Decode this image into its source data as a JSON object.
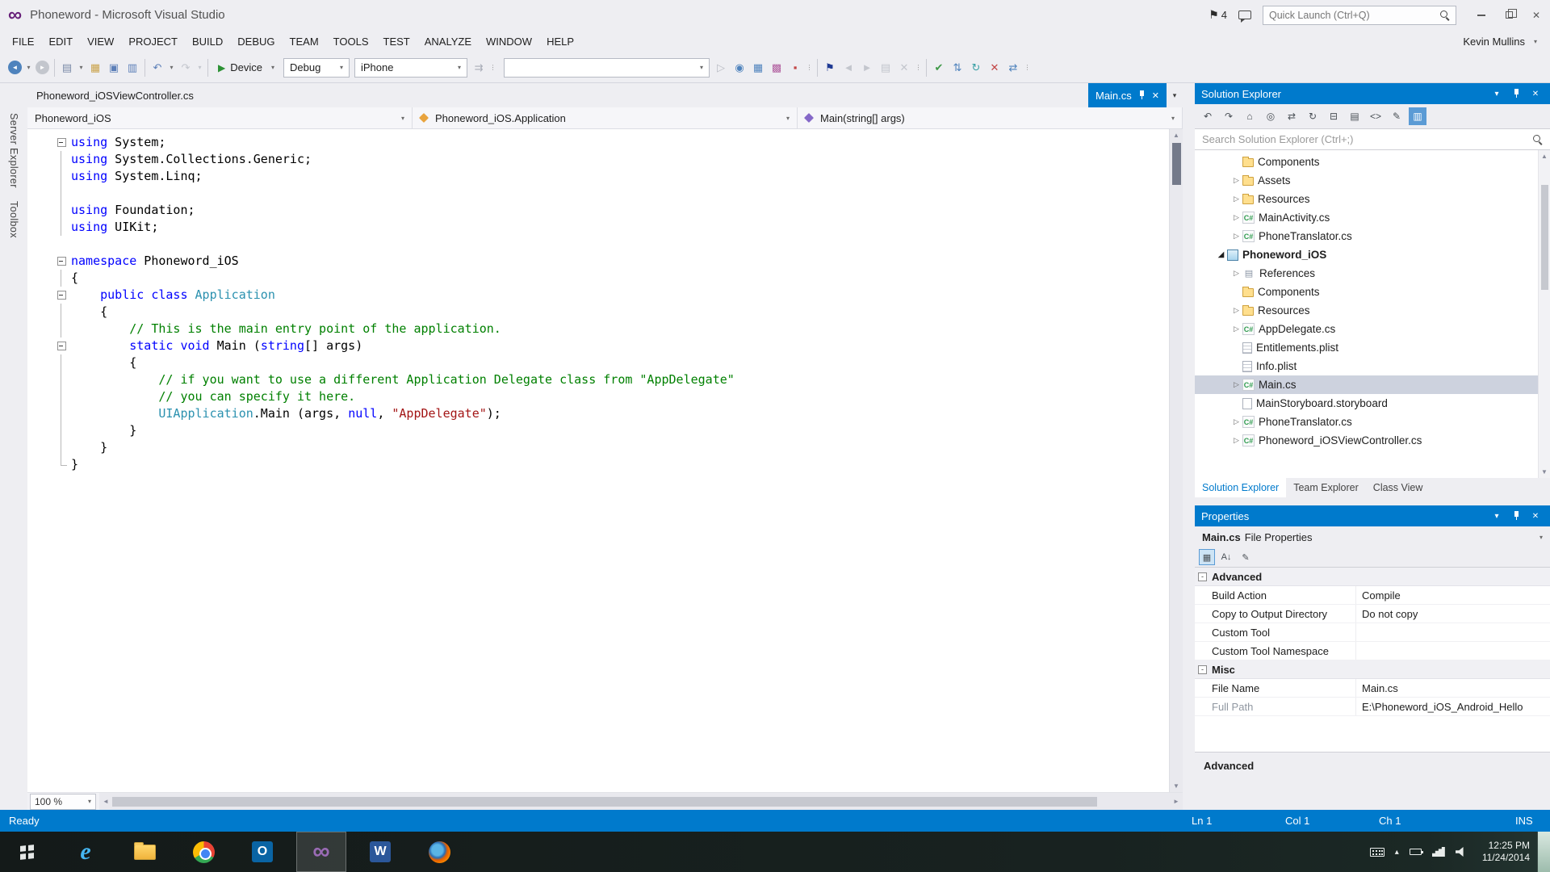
{
  "window": {
    "title": "Phoneword - Microsoft Visual Studio"
  },
  "title_bar": {
    "notification_count": "4",
    "quick_launch_placeholder": "Quick Launch (Ctrl+Q)"
  },
  "menu_bar": {
    "items": [
      "FILE",
      "EDIT",
      "VIEW",
      "PROJECT",
      "BUILD",
      "DEBUG",
      "TEAM",
      "TOOLS",
      "TEST",
      "ANALYZE",
      "WINDOW",
      "HELP"
    ],
    "user": "Kevin Mullins"
  },
  "toolbar": {
    "start_label": "Device",
    "config": "Debug",
    "platform": "iPhone",
    "groups": [
      [
        {
          "n": "navigate-backward-icon",
          "g": "◄",
          "fg": "#ffffff",
          "bg": "#4f83bd",
          "r": true
        },
        {
          "n": "navigate-backward-caret-icon",
          "g": "▾",
          "fg": "#6d6d6d",
          "sm": true
        },
        {
          "n": "navigate-forward-icon",
          "g": "►",
          "fg": "#ffffff",
          "bg": "#c3c6cd",
          "r": true
        }
      ],
      [
        {
          "n": "new-file-icon",
          "g": "▤",
          "fg": "#7a8aa8"
        },
        {
          "n": "new-file-caret-icon",
          "g": "▾",
          "fg": "#6d6d6d",
          "sm": true
        },
        {
          "n": "open-file-icon",
          "g": "▦",
          "fg": "#caa34c"
        },
        {
          "n": "save-icon",
          "g": "▣",
          "fg": "#5c7fb8"
        },
        {
          "n": "save-all-icon",
          "g": "▥",
          "fg": "#5c7fb8"
        }
      ],
      [
        {
          "n": "undo-icon",
          "g": "↶",
          "fg": "#5c7fb8"
        },
        {
          "n": "undo-caret-icon",
          "g": "▾",
          "fg": "#6d6d6d",
          "sm": true
        },
        {
          "n": "redo-icon",
          "g": "↷",
          "fg": "#c3c6cd"
        },
        {
          "n": "redo-caret-icon",
          "g": "▾",
          "fg": "#c3c6cd",
          "sm": true
        }
      ],
      [
        {
          "n": "attach-to-process-icon",
          "g": "⇉",
          "fg": "#a9adb8"
        },
        {
          "n": "toolbar-options-icon",
          "g": "⋮",
          "fg": "#8a8a8a",
          "sm": true
        }
      ],
      [
        {
          "n": "find-next-icon",
          "g": "▷",
          "fg": "#b9bcc4"
        },
        {
          "n": "info-icon",
          "g": "◉",
          "fg": "#4f83bd"
        },
        {
          "n": "data-grid-icon",
          "g": "▦",
          "fg": "#4f83bd"
        },
        {
          "n": "data-table-icon",
          "g": "▩",
          "fg": "#b05c9e"
        },
        {
          "n": "stop-icon",
          "g": "▪",
          "fg": "#c24545"
        },
        {
          "n": "group-overflow-icon",
          "g": "⋮",
          "fg": "#8a8a8a",
          "sm": true
        }
      ],
      [
        {
          "n": "bookmark-icon",
          "g": "⚑",
          "fg": "#1f3a93"
        },
        {
          "n": "previous-bookmark-icon",
          "g": "◄",
          "fg": "#c3c6cd"
        },
        {
          "n": "next-bookmark-icon",
          "g": "►",
          "fg": "#c3c6cd"
        },
        {
          "n": "bookmark-folder-icon",
          "g": "▤",
          "fg": "#c3c6cd"
        },
        {
          "n": "clear-bookmarks-icon",
          "g": "✕",
          "fg": "#c3c6cd"
        },
        {
          "n": "bookmark-overflow-icon",
          "g": "⋮",
          "fg": "#8a8a8a",
          "sm": true
        }
      ],
      [
        {
          "n": "source-control-check-icon",
          "g": "✔",
          "fg": "#3f9948"
        },
        {
          "n": "branch-icon",
          "g": "⇅",
          "fg": "#4f83bd"
        },
        {
          "n": "sync-icon",
          "g": "↻",
          "fg": "#3aa0a5"
        },
        {
          "n": "undo-checkout-icon",
          "g": "✕",
          "fg": "#c24545"
        },
        {
          "n": "compare-icon",
          "g": "⇄",
          "fg": "#4f83bd"
        },
        {
          "n": "history-overflow-icon",
          "g": "⋮",
          "fg": "#8a8a8a",
          "sm": true
        }
      ]
    ]
  },
  "side_tabs": [
    {
      "label": "Server Explorer"
    },
    {
      "label": "Toolbox"
    }
  ],
  "editor": {
    "tabs": [
      {
        "label": "Phoneword_iOSViewController.cs"
      }
    ],
    "preview_tab": {
      "label": "Main.cs"
    },
    "navbar": [
      {
        "label": "Phoneword_iOS"
      },
      {
        "label": "Phoneword_iOS.Application"
      },
      {
        "label": "Main(string[] args)"
      }
    ],
    "zoom": "100 %",
    "code": [
      {
        "m": "box",
        "seg": [
          [
            "kw",
            "using"
          ],
          [
            "pl",
            " System;"
          ]
        ]
      },
      {
        "m": "line",
        "seg": [
          [
            "kw",
            "using"
          ],
          [
            "pl",
            " System.Collections.Generic;"
          ]
        ]
      },
      {
        "m": "line",
        "seg": [
          [
            "kw",
            "using"
          ],
          [
            "pl",
            " System.Linq;"
          ]
        ]
      },
      {
        "m": "line",
        "seg": []
      },
      {
        "m": "line",
        "seg": [
          [
            "kw",
            "using"
          ],
          [
            "pl",
            " Foundation;"
          ]
        ]
      },
      {
        "m": "line",
        "seg": [
          [
            "kw",
            "using"
          ],
          [
            "pl",
            " UIKit;"
          ]
        ]
      },
      {
        "m": "",
        "seg": []
      },
      {
        "m": "box",
        "seg": [
          [
            "kw",
            "namespace"
          ],
          [
            "pl",
            " Phoneword_iOS"
          ]
        ]
      },
      {
        "m": "line",
        "seg": [
          [
            "pl",
            "{"
          ]
        ]
      },
      {
        "m": "box",
        "seg": [
          [
            "pl",
            "    "
          ],
          [
            "kw",
            "public"
          ],
          [
            "pl",
            " "
          ],
          [
            "kw",
            "class"
          ],
          [
            "pl",
            " "
          ],
          [
            "ty",
            "Application"
          ]
        ]
      },
      {
        "m": "line",
        "seg": [
          [
            "pl",
            "    {"
          ]
        ]
      },
      {
        "m": "line",
        "seg": [
          [
            "pl",
            "        "
          ],
          [
            "com",
            "// This is the main entry point of the application."
          ]
        ]
      },
      {
        "m": "box",
        "seg": [
          [
            "pl",
            "        "
          ],
          [
            "kw",
            "static"
          ],
          [
            "pl",
            " "
          ],
          [
            "kw",
            "void"
          ],
          [
            "pl",
            " Main ("
          ],
          [
            "kw",
            "string"
          ],
          [
            "pl",
            "[] args)"
          ]
        ]
      },
      {
        "m": "line",
        "seg": [
          [
            "pl",
            "        {"
          ]
        ]
      },
      {
        "m": "line",
        "seg": [
          [
            "pl",
            "            "
          ],
          [
            "com",
            "// if you want to use a different Application Delegate class from \"AppDelegate\""
          ]
        ]
      },
      {
        "m": "line",
        "seg": [
          [
            "pl",
            "            "
          ],
          [
            "com",
            "// you can specify it here."
          ]
        ]
      },
      {
        "m": "line",
        "seg": [
          [
            "pl",
            "            "
          ],
          [
            "ty",
            "UIApplication"
          ],
          [
            "pl",
            ".Main (args, "
          ],
          [
            "kw",
            "null"
          ],
          [
            "pl",
            ", "
          ],
          [
            "str",
            "\"AppDelegate\""
          ],
          [
            "pl",
            ");"
          ]
        ]
      },
      {
        "m": "line",
        "seg": [
          [
            "pl",
            "        }"
          ]
        ]
      },
      {
        "m": "line",
        "seg": [
          [
            "pl",
            "    }"
          ]
        ]
      },
      {
        "m": "end",
        "seg": [
          [
            "pl",
            "}"
          ]
        ]
      }
    ]
  },
  "solution_explorer": {
    "title": "Solution Explorer",
    "search_placeholder": "Search Solution Explorer (Ctrl+;)",
    "toolbar_icons": [
      {
        "n": "se-back-icon",
        "g": "↶"
      },
      {
        "n": "se-forward-icon",
        "g": "↷"
      },
      {
        "n": "se-home-icon",
        "g": "⌂"
      },
      {
        "n": "se-scope-icon",
        "g": "◎"
      },
      {
        "n": "se-sync-with-active-document-icon",
        "g": "⇄"
      },
      {
        "n": "se-refresh-icon",
        "g": "↻"
      },
      {
        "n": "se-collapse-all-icon",
        "g": "⊟"
      },
      {
        "n": "se-show-all-files-icon",
        "g": "▤"
      },
      {
        "n": "se-view-code-icon",
        "g": "<>"
      },
      {
        "n": "se-properties-icon",
        "g": "✎"
      },
      {
        "n": "se-preview-selected-icon",
        "g": "▥",
        "active": true
      }
    ],
    "tree": [
      {
        "indent": 2,
        "arrow": "none",
        "icon": "folder",
        "label": "Components"
      },
      {
        "indent": 2,
        "arrow": "collapsed",
        "icon": "folder",
        "label": "Assets"
      },
      {
        "indent": 2,
        "arrow": "collapsed",
        "icon": "folder",
        "label": "Resources"
      },
      {
        "indent": 2,
        "arrow": "collapsed",
        "icon": "csharp",
        "label": "MainActivity.cs"
      },
      {
        "indent": 2,
        "arrow": "collapsed",
        "icon": "csharp",
        "label": "PhoneTranslator.cs"
      },
      {
        "indent": 1,
        "arrow": "expanded",
        "icon": "project",
        "label": "Phoneword_iOS",
        "bold": true
      },
      {
        "indent": 2,
        "arrow": "collapsed",
        "icon": "references",
        "label": "References"
      },
      {
        "indent": 2,
        "arrow": "none",
        "icon": "folder",
        "label": "Components"
      },
      {
        "indent": 2,
        "arrow": "collapsed",
        "icon": "folder",
        "label": "Resources"
      },
      {
        "indent": 2,
        "arrow": "collapsed",
        "icon": "csharp",
        "label": "AppDelegate.cs"
      },
      {
        "indent": 2,
        "arrow": "none",
        "icon": "plist",
        "label": "Entitlements.plist"
      },
      {
        "indent": 2,
        "arrow": "none",
        "icon": "plist",
        "label": "Info.plist"
      },
      {
        "indent": 2,
        "arrow": "collapsed",
        "icon": "csharp",
        "label": "Main.cs",
        "selected": true
      },
      {
        "indent": 2,
        "arrow": "none",
        "icon": "storyboard",
        "label": "MainStoryboard.storyboard"
      },
      {
        "indent": 2,
        "arrow": "collapsed",
        "icon": "csharp",
        "label": "PhoneTranslator.cs"
      },
      {
        "indent": 2,
        "arrow": "collapsed",
        "icon": "csharp",
        "label": "Phoneword_iOSViewController.cs"
      }
    ],
    "bottom_tabs": [
      {
        "label": "Solution Explorer",
        "active": true
      },
      {
        "label": "Team Explorer"
      },
      {
        "label": "Class View"
      }
    ]
  },
  "properties_panel": {
    "title": "Properties",
    "object_label": "Main.cs",
    "object_type": "File Properties",
    "toolbar_icons": [
      {
        "n": "categorized-icon",
        "g": "▦",
        "active": true
      },
      {
        "n": "alphabetical-icon",
        "g": "A↓"
      },
      {
        "n": "property-pages-icon",
        "g": "✎"
      }
    ],
    "rows": [
      {
        "type": "category",
        "label": "Advanced"
      },
      {
        "type": "prop",
        "label": "Build Action",
        "value": "Compile"
      },
      {
        "type": "prop",
        "label": "Copy to Output Directory",
        "value": "Do not copy"
      },
      {
        "type": "prop",
        "label": "Custom Tool",
        "value": ""
      },
      {
        "type": "prop",
        "label": "Custom Tool Namespace",
        "value": ""
      },
      {
        "type": "category",
        "label": "Misc"
      },
      {
        "type": "prop",
        "label": "File Name",
        "value": "Main.cs"
      },
      {
        "type": "prop",
        "label": "Full Path",
        "value": "E:\\Phoneword_iOS_Android_Hello",
        "muted": true
      }
    ],
    "description_title": "Advanced"
  },
  "status_bar": {
    "left": "Ready",
    "ln": "Ln 1",
    "col": "Col 1",
    "ch": "Ch 1",
    "mode": "INS"
  },
  "taskbar": {
    "apps": [
      {
        "id": "start"
      },
      {
        "id": "internet-explorer",
        "glyph": "e"
      },
      {
        "id": "file-explorer"
      },
      {
        "id": "chrome"
      },
      {
        "id": "outlook",
        "glyph": "O"
      },
      {
        "id": "visual-studio",
        "glyph": "∞",
        "active": true
      },
      {
        "id": "word",
        "glyph": "W"
      },
      {
        "id": "firefox"
      }
    ],
    "tray_icons": [
      {
        "id": "touch-keyboard"
      },
      {
        "id": "show-hidden",
        "glyph": "▴"
      },
      {
        "id": "power"
      },
      {
        "id": "network"
      },
      {
        "id": "volume"
      }
    ],
    "clock_time": "12:25 PM",
    "clock_date": "11/24/2014"
  },
  "colors": {
    "accent": "#007acc",
    "keyword": "#0000ff",
    "type_name": "#2b91af",
    "string_literal": "#a31515",
    "comment": "#008000",
    "selection": "#cdd2de"
  }
}
